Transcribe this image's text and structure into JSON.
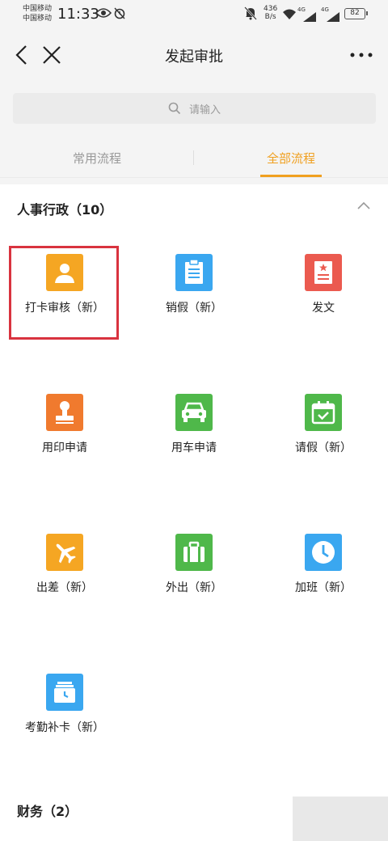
{
  "status_bar": {
    "carrier_1": "中国移动",
    "carrier_2": "中国移动",
    "time": "11:33",
    "net_speed_value": "436",
    "net_speed_unit": "B/s",
    "signal_tag_1": "4G",
    "signal_tag_2": "4G",
    "battery": "82"
  },
  "nav": {
    "title": "发起审批"
  },
  "search": {
    "placeholder": "请输入"
  },
  "tabs": [
    {
      "label": "常用流程",
      "active": false
    },
    {
      "label": "全部流程",
      "active": true
    }
  ],
  "sections": [
    {
      "title": "人事行政（10）",
      "expanded": true,
      "items": [
        {
          "label": "打卡审核（新）",
          "icon": "person-icon",
          "color": "#f5a623",
          "highlighted": true
        },
        {
          "label": "销假（新）",
          "icon": "document-icon",
          "color": "#3aa7f0"
        },
        {
          "label": "发文",
          "icon": "official-document-icon",
          "color": "#eb5a4f"
        },
        {
          "label": "用印申请",
          "icon": "stamp-icon",
          "color": "#f07a2e"
        },
        {
          "label": "用车申请",
          "icon": "car-icon",
          "color": "#4fb84a"
        },
        {
          "label": "请假（新）",
          "icon": "calendar-check-icon",
          "color": "#4fb84a"
        },
        {
          "label": "出差（新）",
          "icon": "airplane-icon",
          "color": "#f5a623"
        },
        {
          "label": "外出（新）",
          "icon": "briefcase-icon",
          "color": "#4fb84a"
        },
        {
          "label": "加班（新）",
          "icon": "clock-icon",
          "color": "#3aa7f0"
        },
        {
          "label": "考勤补卡（新）",
          "icon": "attendance-icon",
          "color": "#3aa7f0"
        }
      ]
    },
    {
      "title": "财务（2）",
      "expanded": false,
      "items": []
    }
  ],
  "colors": {
    "accent": "#f0a020",
    "highlight": "#d9333f",
    "background_gray": "#f4f4f4"
  }
}
